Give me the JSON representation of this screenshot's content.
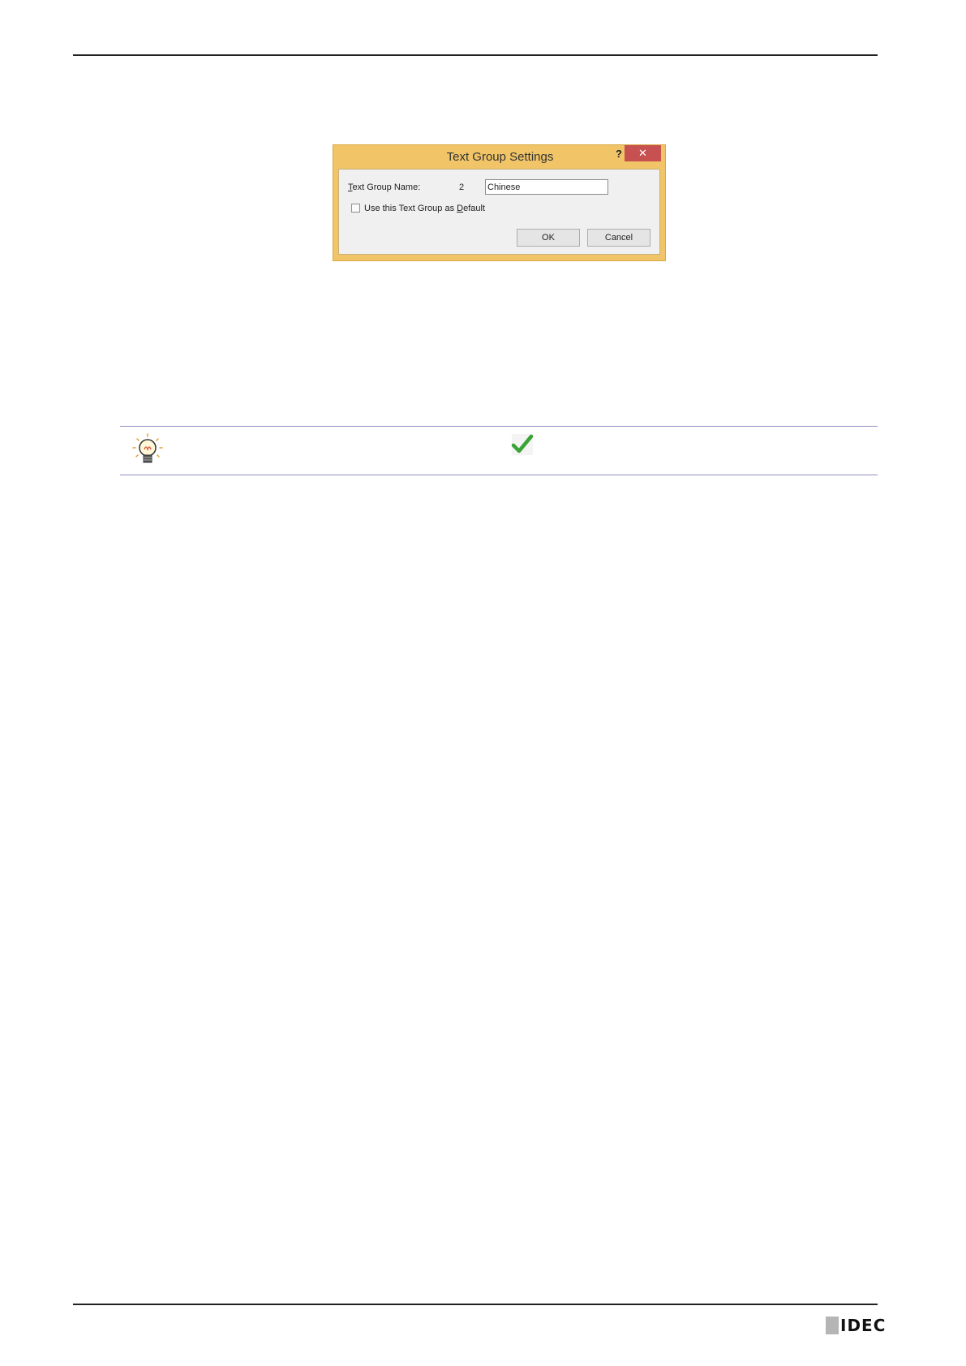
{
  "dialog": {
    "title": "Text Group Settings",
    "help_label": "?",
    "close_label": "✕",
    "name_label_accel": "T",
    "name_label_rest": "ext Group Name:",
    "group_number": "2",
    "name_value": "Chinese",
    "default_checkbox_checked": false,
    "checkbox_label_pre": "Use this Text Group as ",
    "checkbox_label_accel": "D",
    "checkbox_label_post": "efault",
    "ok_label": "OK",
    "cancel_label": "Cancel"
  },
  "hint": {
    "icon": "lightbulb-icon",
    "check_icon": "checkmark-icon",
    "check_color": "#3aa335"
  },
  "footer": {
    "logo_text": "IDEC"
  }
}
